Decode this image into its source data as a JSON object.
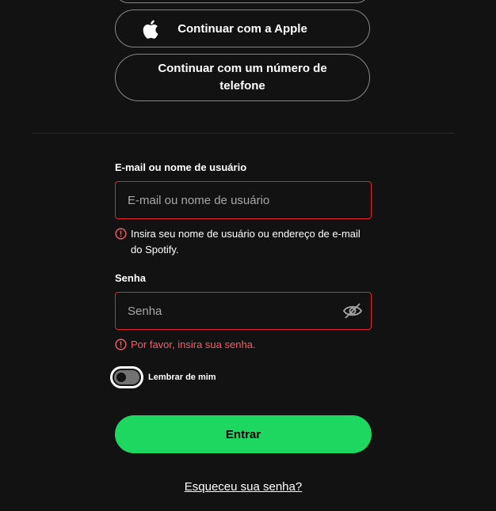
{
  "social": {
    "apple_label": "Continuar com a Apple",
    "phone_label": "Continuar com um número de telefone"
  },
  "email": {
    "label": "E-mail ou nome de usuário",
    "placeholder": "E-mail ou nome de usuário",
    "value": "",
    "error": "Insira seu nome de usuário ou endereço de e-mail do Spotify."
  },
  "password": {
    "label": "Senha",
    "placeholder": "Senha",
    "value": "",
    "error": "Por favor, insira sua senha."
  },
  "remember": {
    "label": "Lembrar de mim",
    "checked": false
  },
  "login_button": "Entrar",
  "forgot_link": "Esqueceu sua senha?",
  "colors": {
    "background": "#121212",
    "accent": "#1ed760",
    "error_border": "#e22134",
    "error_text": "#f15e6c"
  },
  "icons": {
    "apple": "apple-icon",
    "error": "error-icon",
    "eye": "eye-hidden-icon"
  }
}
